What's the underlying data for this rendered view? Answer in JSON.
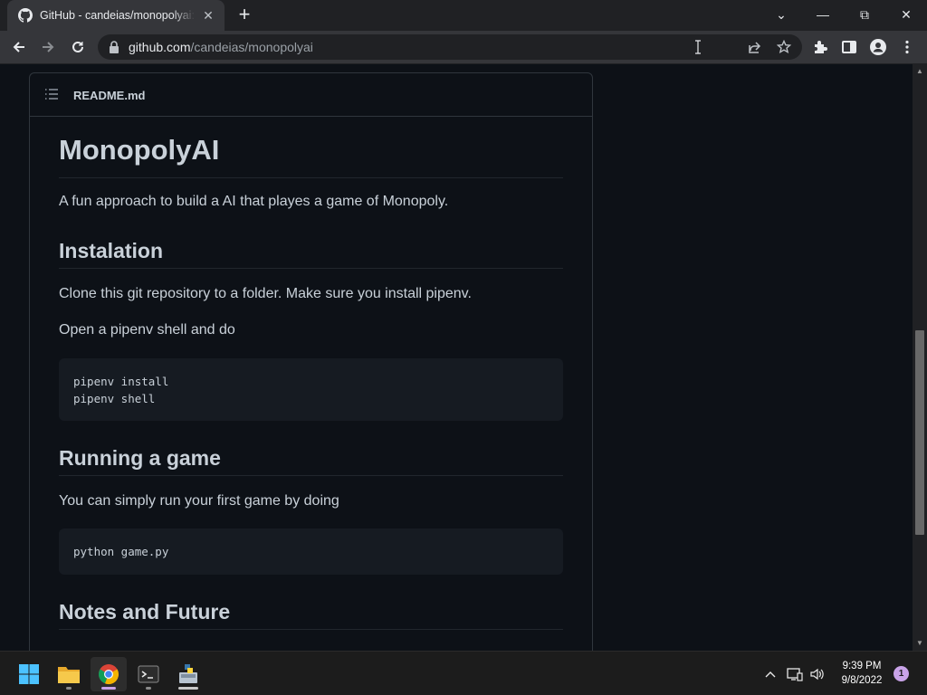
{
  "browser": {
    "tab_title": "GitHub - candeias/monopolyai: A fun approach to build a AI that playes a game of Monopoly.",
    "close_tab_glyph": "✕",
    "new_tab_glyph": "+",
    "url_host": "github.com",
    "url_path": "/candeias/monopolyai",
    "window_controls": {
      "tab_search": "⌄",
      "minimize": "—",
      "restore": "⧉",
      "close": "✕"
    }
  },
  "readme": {
    "filename": "README.md",
    "title": "MonopolyAI",
    "intro": "A fun approach to build a AI that playes a game of Monopoly.",
    "installation": {
      "heading": "Instalation",
      "p1": "Clone this git repository to a folder. Make sure you install pipenv.",
      "p2": "Open a pipenv shell and do",
      "code": "pipenv install\npipenv shell"
    },
    "running": {
      "heading": "Running a game",
      "p1": "You can simply run your first game by doing",
      "code": "python game.py"
    },
    "notes": {
      "heading": "Notes and Future"
    }
  },
  "taskbar": {
    "apps": [
      "start-icon",
      "file-explorer-icon",
      "chrome-icon",
      "terminal-icon",
      "python-installer-icon"
    ],
    "time": "9:39 PM",
    "date": "9/8/2022",
    "notification_count": "1"
  },
  "colors": {
    "page_bg": "#0d1117",
    "text": "#c9d1d9",
    "border": "#30363d",
    "code_bg": "#161b22"
  }
}
